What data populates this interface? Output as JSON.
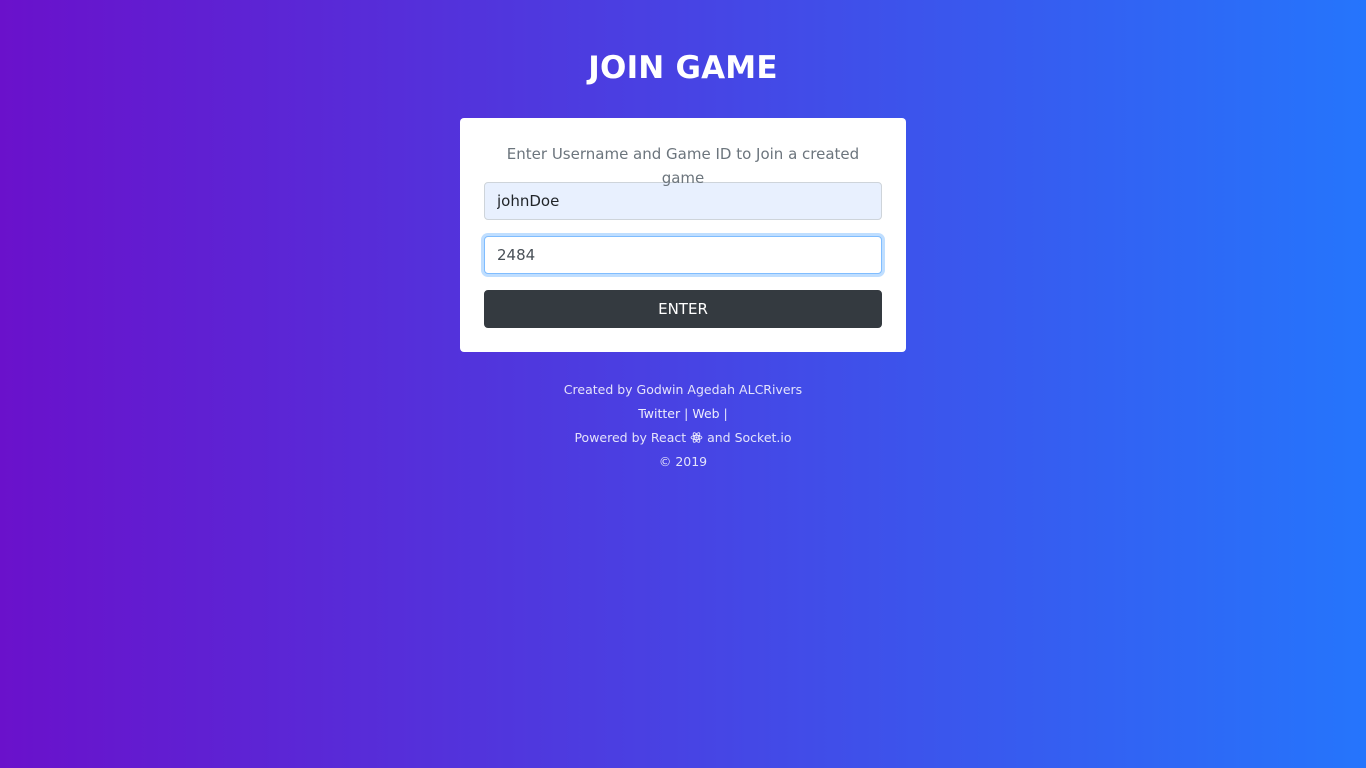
{
  "page": {
    "title": "JOIN GAME"
  },
  "form": {
    "subtitle": "Enter Username and Game ID to Join a created game",
    "username_value": "johnDoe",
    "gameid_value": "2484",
    "enter_label": "ENTER"
  },
  "footer": {
    "created_by": "Created by Godwin Agedah ALCRivers",
    "twitter_label": "Twitter",
    "separator_1": " | ",
    "web_label": "Web",
    "separator_2": " |",
    "powered_prefix": "Powered by ",
    "react_label": "React",
    "react_icon": "react-atom-icon",
    "and_text": " and ",
    "socket_label": "Socket.io",
    "copyright": "© 2019"
  },
  "colors": {
    "gradient_start": "#6a11cb",
    "gradient_end": "#2575fc",
    "button_bg": "#343a40",
    "username_bg": "#e8f0fe",
    "focus_border": "#80bdff"
  }
}
